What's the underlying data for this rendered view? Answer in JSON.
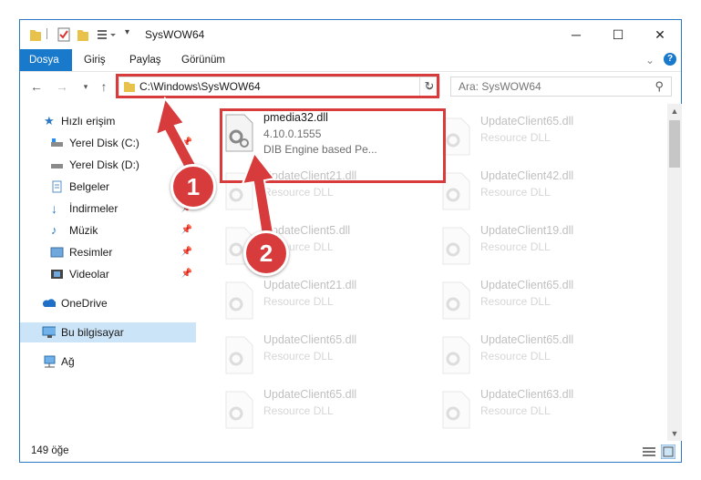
{
  "window": {
    "title": "SysWOW64",
    "minimize": "─",
    "maximize": "☐",
    "close": "✕"
  },
  "ribbon": {
    "tabs": [
      "Dosya",
      "Giriş",
      "Paylaş",
      "Görünüm"
    ]
  },
  "nav": {
    "address": "C:\\Windows\\SysWOW64",
    "search_placeholder": "Ara: SysWOW64"
  },
  "sidebar": {
    "items": [
      {
        "label": "Hızlı erişim",
        "icon": "star-icon"
      },
      {
        "label": "Yerel Disk (C:)",
        "icon": "drive-icon"
      },
      {
        "label": "Yerel Disk (D:)",
        "icon": "drive-icon"
      },
      {
        "label": "Belgeler",
        "icon": "documents-icon"
      },
      {
        "label": "İndirmeler",
        "icon": "download-icon"
      },
      {
        "label": "Müzik",
        "icon": "music-icon"
      },
      {
        "label": "Resimler",
        "icon": "pictures-icon"
      },
      {
        "label": "Videolar",
        "icon": "videos-icon"
      },
      {
        "label": "OneDrive",
        "icon": "cloud-icon"
      },
      {
        "label": "Bu bilgisayar",
        "icon": "computer-icon"
      },
      {
        "label": "Ağ",
        "icon": "network-icon"
      }
    ]
  },
  "files": {
    "main": {
      "name": "pmedia32.dll",
      "version": "4.10.0.1555",
      "desc": "DIB Engine based Pe..."
    },
    "left": [
      {
        "name": "UpdateClient21.dll",
        "desc": "Resource DLL"
      },
      {
        "name": "UpdateClient5.dll",
        "desc": "Resource DLL"
      },
      {
        "name": "UpdateClient21.dll",
        "desc": "Resource DLL"
      },
      {
        "name": "UpdateClient65.dll",
        "desc": "Resource DLL"
      },
      {
        "name": "UpdateClient65.dll",
        "desc": "Resource DLL"
      }
    ],
    "right": [
      {
        "name": "UpdateClient65.dll",
        "desc": "Resource DLL"
      },
      {
        "name": "UpdateClient42.dll",
        "desc": "Resource DLL"
      },
      {
        "name": "UpdateClient19.dll",
        "desc": "Resource DLL"
      },
      {
        "name": "UpdateClient65.dll",
        "desc": "Resource DLL"
      },
      {
        "name": "UpdateClient65.dll",
        "desc": "Resource DLL"
      },
      {
        "name": "UpdateClient63.dll",
        "desc": "Resource DLL"
      }
    ]
  },
  "status": {
    "count": "149 öğe"
  },
  "annotations": {
    "step1": "1",
    "step2": "2"
  },
  "colors": {
    "accent": "#1979ca",
    "highlight": "#d83b3b"
  }
}
